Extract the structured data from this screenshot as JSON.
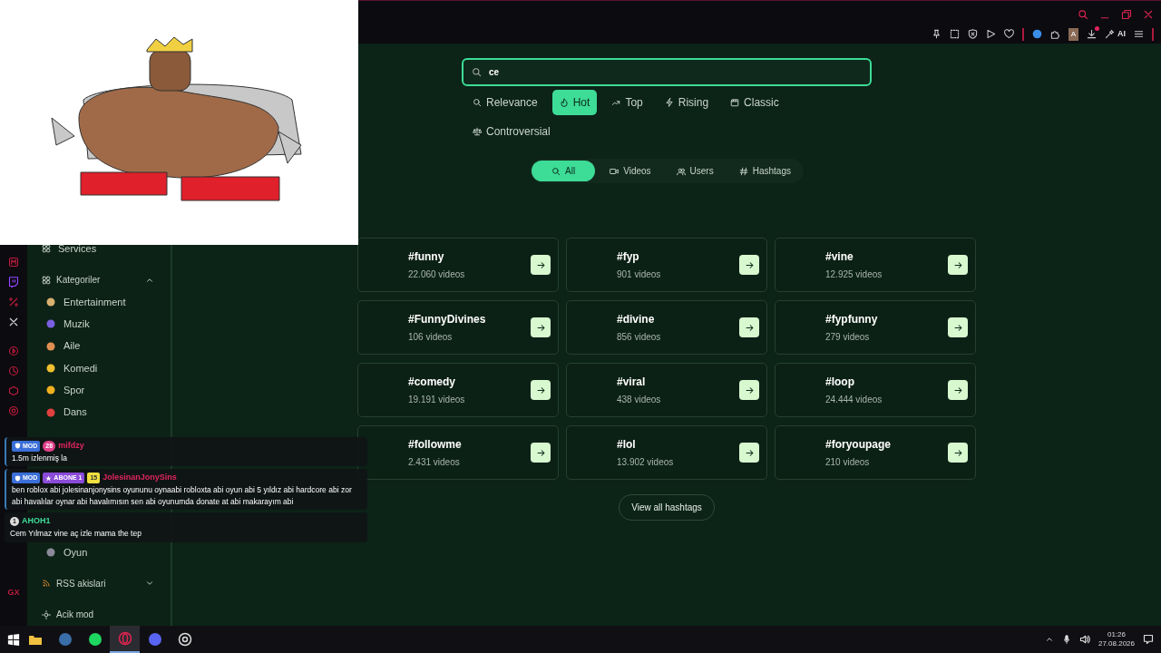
{
  "browser": {
    "avatar_letter": "A",
    "ai_label": "AI",
    "download_notification": true
  },
  "rail": {
    "logo_text": "GX"
  },
  "sidebar": {
    "services": "Services",
    "categories": {
      "label": "Kategoriler",
      "expanded": true,
      "items": [
        "Entertainment",
        "Muzik",
        "Aile",
        "Komedi",
        "Spor",
        "Dans"
      ]
    },
    "lower_items": [
      "Oyun"
    ],
    "rss": {
      "label": "RSS akislari",
      "expanded": false
    },
    "bottom": "Acik mod"
  },
  "search": {
    "value": "ce"
  },
  "sort_tabs": [
    {
      "label": "Relevance",
      "selected": false
    },
    {
      "label": "Hot",
      "selected": true
    },
    {
      "label": "Top",
      "selected": false
    },
    {
      "label": "Rising",
      "selected": false
    },
    {
      "label": "Classic",
      "selected": false
    },
    {
      "label": "Controversial",
      "selected": false
    }
  ],
  "filters": [
    {
      "label": "All",
      "selected": true
    },
    {
      "label": "Videos",
      "selected": false
    },
    {
      "label": "Users",
      "selected": false
    },
    {
      "label": "Hashtags",
      "selected": false
    }
  ],
  "hashtags": [
    {
      "tag": "#funny",
      "count": "22.060 videos"
    },
    {
      "tag": "#fyp",
      "count": "901 videos"
    },
    {
      "tag": "#vine",
      "count": "12.925 videos"
    },
    {
      "tag": "#FunnyDivines",
      "count": "106 videos"
    },
    {
      "tag": "#divine",
      "count": "856 videos"
    },
    {
      "tag": "#fypfunny",
      "count": "279 videos"
    },
    {
      "tag": "#comedy",
      "count": "19.191 videos"
    },
    {
      "tag": "#viral",
      "count": "438 videos"
    },
    {
      "tag": "#loop",
      "count": "24.444 videos"
    },
    {
      "tag": "#followme",
      "count": "2.431 videos"
    },
    {
      "tag": "#lol",
      "count": "13.902 videos"
    },
    {
      "tag": "#foryoupage",
      "count": "210 videos"
    }
  ],
  "view_all": "View all hashtags",
  "chat": [
    {
      "badges": [
        {
          "kind": "mod",
          "label": "MOD"
        },
        {
          "kind": "emote",
          "label": "28"
        }
      ],
      "user": "mifdzy",
      "color": "#e0245e",
      "text": "1.5m izlenmiş la"
    },
    {
      "badges": [
        {
          "kind": "mod",
          "label": "MOD"
        },
        {
          "kind": "sub",
          "label": "ABONE 1"
        },
        {
          "kind": "level",
          "label": "15"
        }
      ],
      "user": "JolesinanJonySins",
      "color": "#e0245e",
      "text": "ben roblox abi jolesinanjonysins oyununu oynaabi robloxta abi oyun abi 5 yıldız abi hardcore abi zor abi havalılar oynar abi havalımısın sen abi oyunumda donate at abi makarayım abi"
    },
    {
      "badges": [
        {
          "kind": "rank",
          "label": "1"
        }
      ],
      "user": "AHOH1",
      "color": "#3ddc97",
      "text": "Cem Yılmaz vine aç izle mama the tep"
    }
  ],
  "taskbar": {
    "apps": [
      {
        "active": false
      },
      {
        "active": false
      },
      {
        "active": false
      },
      {
        "active": true
      },
      {
        "active": false
      },
      {
        "active": false
      }
    ],
    "time": "01:26",
    "date": "27.08.2026"
  }
}
